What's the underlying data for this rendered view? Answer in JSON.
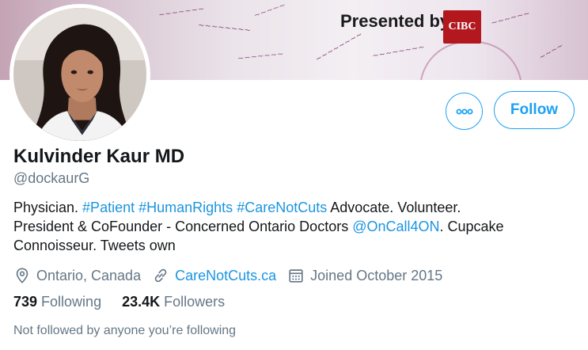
{
  "banner": {
    "presented_text": "Presented by:",
    "sponsor_logo_text": "CIBC"
  },
  "profile": {
    "name": "Kulvinder Kaur MD",
    "handle": "@dockaurG",
    "avatar_icon": "profile-photo"
  },
  "actions": {
    "more_icon": "more-horizontal-icon",
    "follow_label": "Follow"
  },
  "bio": {
    "line1": [
      {
        "text": "Physician. ",
        "link": false
      },
      {
        "text": "#Patient",
        "link": true
      },
      {
        "text": " ",
        "link": false
      },
      {
        "text": "#HumanRights",
        "link": true
      },
      {
        "text": " ",
        "link": false
      },
      {
        "text": "#CareNotCuts",
        "link": true
      },
      {
        "text": " Advocate. Volunteer.",
        "link": false
      }
    ],
    "line2": [
      {
        "text": "President & CoFounder - Concerned Ontario Doctors ",
        "link": false
      },
      {
        "text": "@OnCall4ON",
        "link": true
      },
      {
        "text": ". Cupcake",
        "link": false
      }
    ],
    "line3": [
      {
        "text": "Connoisseur. Tweets own",
        "link": false
      }
    ]
  },
  "meta": {
    "location": "Ontario, Canada",
    "location_icon": "location-pin-icon",
    "website": "CareNotCuts.ca",
    "website_icon": "link-icon",
    "joined": "Joined October 2015",
    "joined_icon": "calendar-icon"
  },
  "stats": {
    "following_count": "739",
    "following_label": "Following",
    "followers_count": "23.4K",
    "followers_label": "Followers"
  },
  "followed_by": "Not followed by anyone you’re following",
  "colors": {
    "accent": "#1da1f2",
    "link": "#1b95e0",
    "secondary_text": "#657786",
    "primary_text": "#14171a"
  }
}
